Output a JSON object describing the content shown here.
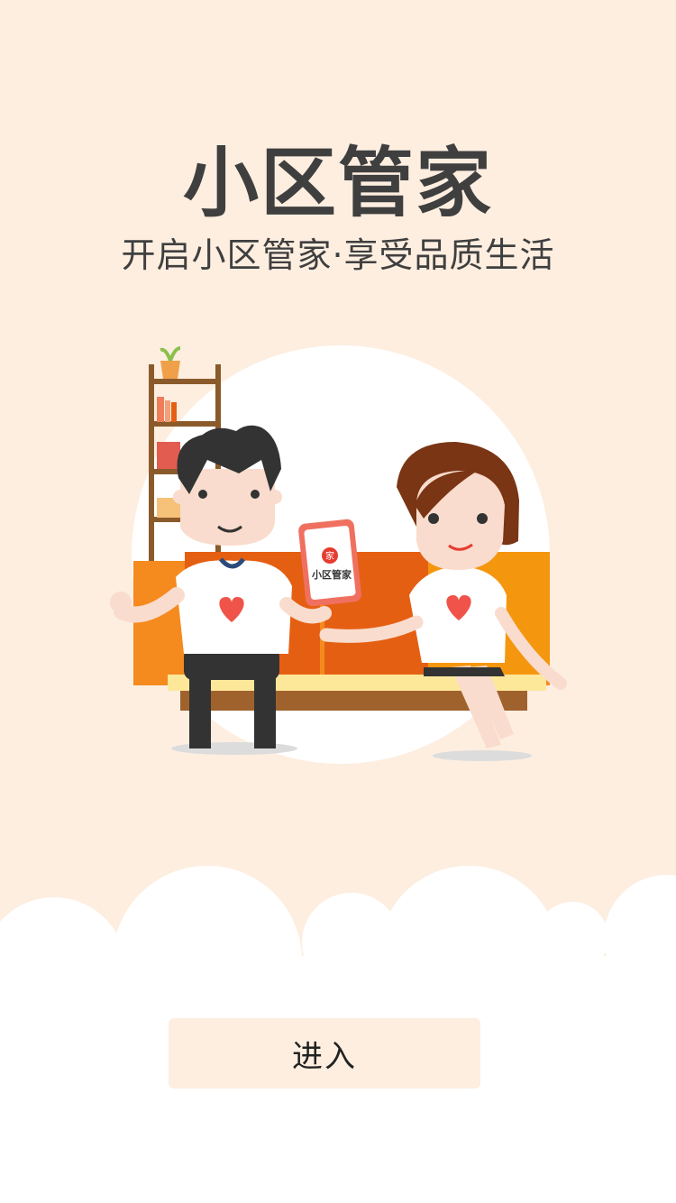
{
  "header": {
    "title": "小区管家",
    "subtitle": "开启小区管家·享受品质生活"
  },
  "illustration": {
    "phone_screen_title": "小区管家",
    "phone_badge": "家"
  },
  "actions": {
    "enter_label": "进入"
  },
  "colors": {
    "background": "#fdeee0",
    "sofa": "#f58a1f",
    "sofa_dark": "#e55f13",
    "heart": "#f0534a",
    "text": "#3f3f3f"
  }
}
